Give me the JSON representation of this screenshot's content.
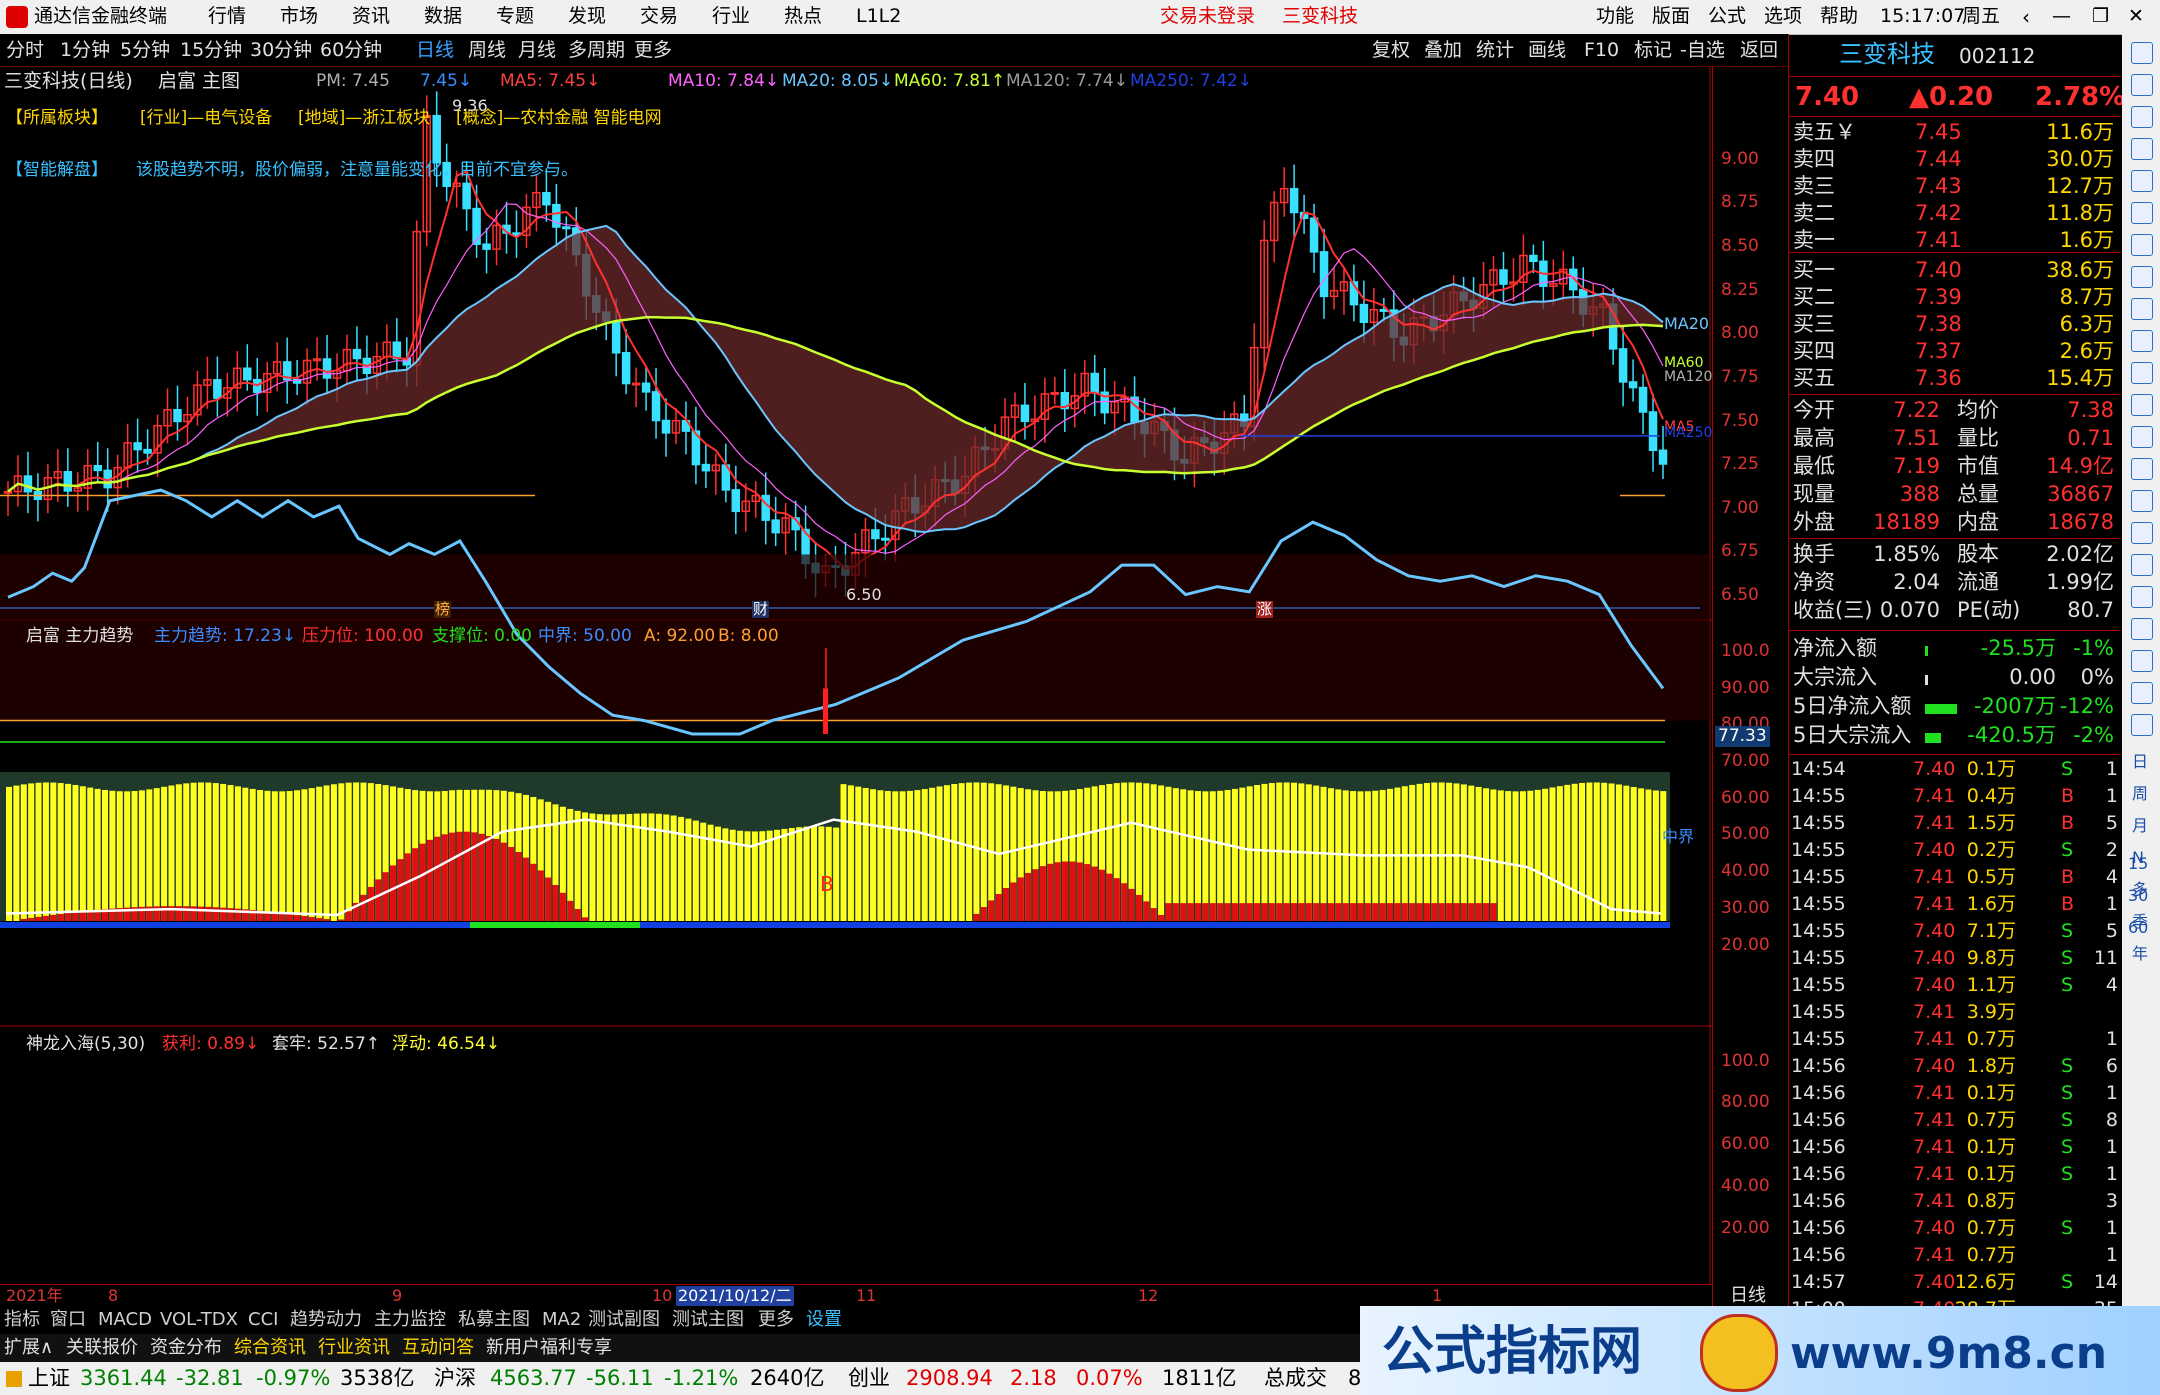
{
  "menubar": {
    "app_title": "通达信金融终端",
    "items": [
      "行情",
      "市场",
      "资讯",
      "数据",
      "专题",
      "发现",
      "交易",
      "行业",
      "热点",
      "L1L2"
    ],
    "login": "交易未登录",
    "stock": "三变科技",
    "right_items": [
      "功能",
      "版面",
      "公式",
      "选项",
      "帮助"
    ],
    "time": "15:17:07",
    "weekday": "周五"
  },
  "periodbar": {
    "items": [
      "分时",
      "1分钟",
      "5分钟",
      "15分钟",
      "30分钟",
      "60分钟",
      "日线",
      "周线",
      "月线",
      "多周期",
      "更多"
    ],
    "active": "日线",
    "tools": [
      "复权",
      "叠加",
      "统计",
      "画线",
      "F10",
      "标记",
      "-自选",
      "返回"
    ]
  },
  "main_chart": {
    "name": "三变科技(日线)",
    "template": "启富 主图",
    "ma_labels": [
      {
        "text": "PM: 7.45",
        "color": "#b0b0b0"
      },
      {
        "text": "7.45↓",
        "color": "#3a8cff"
      },
      {
        "text": "MA5: 7.45↓",
        "color": "#ff4040"
      },
      {
        "text": "MA10: 7.84↓",
        "color": "#ff60ff"
      },
      {
        "text": "MA20: 8.05↓",
        "color": "#6ac6ff"
      },
      {
        "text": "MA60: 7.81↑",
        "color": "#c8ff30"
      },
      {
        "text": "MA120: 7.74↓",
        "color": "#9a9a9a"
      },
      {
        "text": "MA250: 7.42↓",
        "color": "#2040e0"
      }
    ],
    "sector_label": "【所属板块】",
    "sector_industry": "[行业]—电气设备",
    "sector_region": "[地域]—浙江板块",
    "sector_concept": "[概念]—农村金融 智能电网",
    "analysis_label": "【智能解盘】",
    "analysis_text": "该股趋势不明，股价偏弱，注意量能变化，目前不宜参与。",
    "high_label": "9.36",
    "low_label": "6.50",
    "y_ticks": [
      "9.00",
      "8.75",
      "8.50",
      "8.25",
      "8.00",
      "7.75",
      "7.50",
      "7.25",
      "7.00",
      "6.75",
      "6.50"
    ],
    "line_tags": [
      "MA20",
      "MA60",
      "MA120",
      "MA5",
      "MA250"
    ],
    "event_marks": [
      "榜",
      "财",
      "涨"
    ]
  },
  "trend_panel": {
    "title": "启富 主力趋势",
    "labels": [
      {
        "text": "主力趋势: 17.23↓",
        "color": "#3a8cff"
      },
      {
        "text": "压力位: 100.00",
        "color": "#ff3030"
      },
      {
        "text": "支撑位: 0.00",
        "color": "#20e020"
      },
      {
        "text": "中界: 50.00",
        "color": "#3a8cff"
      },
      {
        "text": "A: 92.00",
        "color": "#ffa030"
      },
      {
        "text": "B: 8.00",
        "color": "#ffa030"
      }
    ],
    "y_ticks": [
      "100.0",
      "90.00",
      "80.00",
      "70.00",
      "60.00",
      "50.00",
      "40.00",
      "30.00",
      "20.00"
    ],
    "current_value": "77.33",
    "mid_label": "中界",
    "b_mark": "B"
  },
  "dragon_panel": {
    "title": "神龙入海(5,30)",
    "labels": [
      {
        "text": "获利: 0.89↓",
        "color": "#ff3030"
      },
      {
        "text": "套牢: 52.57↑",
        "color": "#e0e0e0"
      },
      {
        "text": "浮动: 46.54↓",
        "color": "#ffff30"
      }
    ],
    "y_ticks": [
      "100.0",
      "80.00",
      "60.00",
      "40.00",
      "20.00"
    ]
  },
  "time_axis": {
    "labels": [
      "2021年",
      "8",
      "9",
      "10",
      "2021/10/12/二",
      "11",
      "12",
      "1"
    ],
    "period": "日线"
  },
  "quote": {
    "name": "三变科技",
    "code": "002112",
    "price": "7.40",
    "change": "▲0.20",
    "pct": "2.78%",
    "asks": [
      {
        "label": "卖五￥",
        "price": "7.45",
        "vol": "11.6万"
      },
      {
        "label": "卖四",
        "price": "7.44",
        "vol": "30.0万"
      },
      {
        "label": "卖三",
        "price": "7.43",
        "vol": "12.7万"
      },
      {
        "label": "卖二",
        "price": "7.42",
        "vol": "11.8万"
      },
      {
        "label": "卖一",
        "price": "7.41",
        "vol": "1.6万"
      }
    ],
    "bids": [
      {
        "label": "买一",
        "price": "7.40",
        "vol": "38.6万"
      },
      {
        "label": "买二",
        "price": "7.39",
        "vol": "8.7万"
      },
      {
        "label": "买三",
        "price": "7.38",
        "vol": "6.3万"
      },
      {
        "label": "买四",
        "price": "7.37",
        "vol": "2.6万"
      },
      {
        "label": "买五",
        "price": "7.36",
        "vol": "15.4万"
      }
    ],
    "stats": [
      {
        "l1": "今开",
        "v1": "7.22",
        "l2": "均价",
        "v2": "7.38"
      },
      {
        "l1": "最高",
        "v1": "7.51",
        "l2": "量比",
        "v2": "0.71"
      },
      {
        "l1": "最低",
        "v1": "7.19",
        "l2": "市值",
        "v2": "14.9亿"
      },
      {
        "l1": "现量",
        "v1": "388",
        "l2": "总量",
        "v2": "36867"
      },
      {
        "l1": "外盘",
        "v1": "18189",
        "l2": "内盘",
        "v2": "18678"
      }
    ],
    "stats2": [
      {
        "l1": "换手",
        "v1": "1.85%",
        "l2": "股本",
        "v2": "2.02亿"
      },
      {
        "l1": "净资",
        "v1": "2.04",
        "l2": "流通",
        "v2": "1.99亿"
      },
      {
        "l1": "收益(三)",
        "v1": "0.070",
        "l2": "PE(动)",
        "v2": "80.7"
      }
    ],
    "flows": [
      {
        "l": "净流入额",
        "v": "-25.5万",
        "p": "-1%"
      },
      {
        "l": "大宗流入",
        "v": "0.00",
        "p": "0%"
      },
      {
        "l": "5日净流入额",
        "v": "-2007万",
        "p": "-12%"
      },
      {
        "l": "5日大宗流入",
        "v": "-420.5万",
        "p": "-2%"
      }
    ],
    "ticks": [
      [
        "14:54",
        "7.40",
        "0.1万",
        "S",
        "1"
      ],
      [
        "14:55",
        "7.41",
        "0.4万",
        "B",
        "1"
      ],
      [
        "14:55",
        "7.41",
        "1.5万",
        "B",
        "5"
      ],
      [
        "14:55",
        "7.40",
        "0.2万",
        "S",
        "2"
      ],
      [
        "14:55",
        "7.41",
        "0.5万",
        "B",
        "4"
      ],
      [
        "14:55",
        "7.41",
        "1.6万",
        "B",
        "1"
      ],
      [
        "14:55",
        "7.40",
        "7.1万",
        "S",
        "5"
      ],
      [
        "14:55",
        "7.40",
        "9.8万",
        "S",
        "11"
      ],
      [
        "14:55",
        "7.40",
        "1.1万",
        "S",
        "4"
      ],
      [
        "14:55",
        "7.41",
        "3.9万",
        "",
        ""
      ],
      [
        "14:55",
        "7.41",
        "0.7万",
        "",
        "1"
      ],
      [
        "14:56",
        "7.40",
        "1.8万",
        "S",
        "6"
      ],
      [
        "14:56",
        "7.41",
        "0.1万",
        "S",
        "1"
      ],
      [
        "14:56",
        "7.41",
        "0.7万",
        "S",
        "8"
      ],
      [
        "14:56",
        "7.41",
        "0.1万",
        "S",
        "1"
      ],
      [
        "14:56",
        "7.41",
        "0.1万",
        "S",
        "1"
      ],
      [
        "14:56",
        "7.41",
        "0.8万",
        "",
        "3"
      ],
      [
        "14:56",
        "7.40",
        "0.7万",
        "S",
        "1"
      ],
      [
        "14:56",
        "7.41",
        "0.7万",
        "",
        "1"
      ],
      [
        "14:57",
        "7.40",
        "12.6万",
        "S",
        "14"
      ],
      [
        "15:00",
        "7.40",
        "28.7万",
        "",
        "35"
      ]
    ]
  },
  "sidebar": [
    "日",
    "周",
    "月",
    "N",
    "多",
    "季",
    "年",
    "15",
    "30",
    "60"
  ],
  "bottom_tabs1": [
    "指标",
    "窗口",
    "MACD",
    "VOL-TDX",
    "CCI",
    "趋势动力",
    "主力监控",
    "私募主图",
    "MA2",
    "测试副图",
    "测试主图",
    "更多",
    "设置"
  ],
  "bottom_tabs2": [
    "扩展∧",
    "关联报价",
    "资金分布",
    "综合资讯",
    "行业资讯",
    "互动问答",
    "新用户福利专享"
  ],
  "statusbar": {
    "items": [
      {
        "name": "上证",
        "val": "3361.44",
        "chg": "-32.81",
        "pct": "-0.97%",
        "amt": "3538亿"
      },
      {
        "name": "沪深",
        "val": "4563.77",
        "chg": "-56.11",
        "pct": "-1.21%",
        "amt": "2640亿"
      },
      {
        "name": "创业",
        "val": "2908.94",
        "chg": "2.18",
        "pct": "0.07%",
        "amt": "1811亿"
      }
    ],
    "last": "总成交",
    "last_val": "8"
  },
  "banner": {
    "text": "公式指标网",
    "url": "www.9m8.cn"
  }
}
